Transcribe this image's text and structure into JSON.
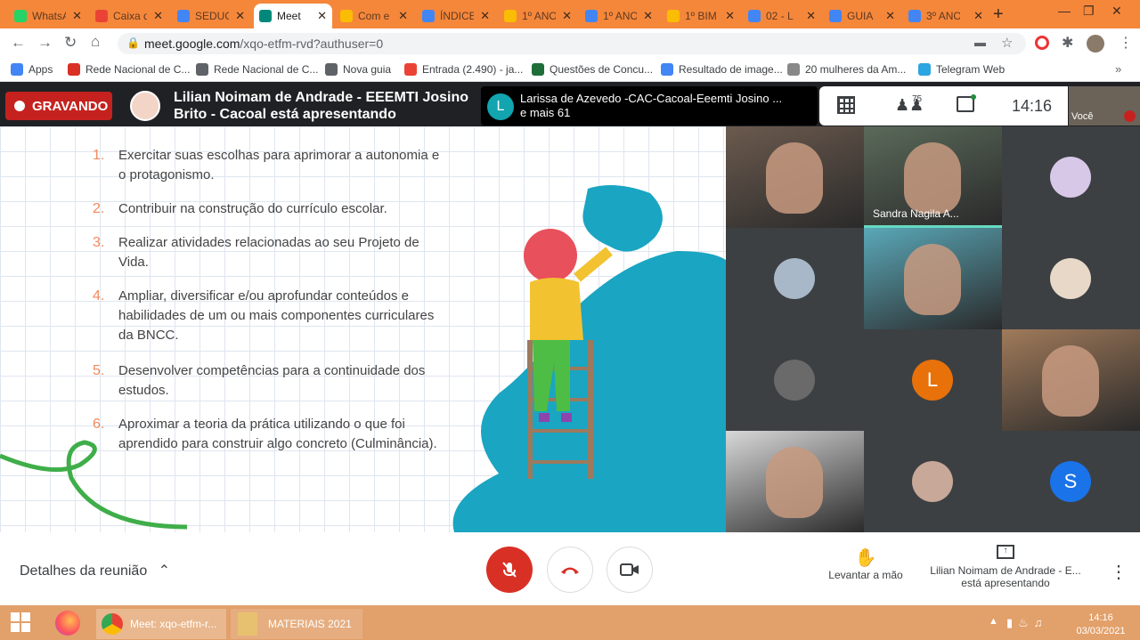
{
  "tabs": [
    {
      "label": "WhatsApp",
      "color": "#25d366"
    },
    {
      "label": "Caixa de",
      "color": "#ea4335"
    },
    {
      "label": "SEDUC",
      "color": "#4285f4"
    },
    {
      "label": "Meet",
      "color": "#00897b"
    },
    {
      "label": "Com e",
      "color": "#fbbc04"
    },
    {
      "label": "ÍNDICE",
      "color": "#4285f4"
    },
    {
      "label": "1º ANO",
      "color": "#fbbc04"
    },
    {
      "label": "1º ANO",
      "color": "#4285f4"
    },
    {
      "label": "1º BIM",
      "color": "#fbbc04"
    },
    {
      "label": "02 - L",
      "color": "#4285f4"
    },
    {
      "label": "GUIA",
      "color": "#4285f4"
    },
    {
      "label": "3º ANO",
      "color": "#4285f4"
    }
  ],
  "address": {
    "host": "meet.google.com",
    "path": "/xqo-etfm-rvd?authuser=0"
  },
  "bookmarks": [
    {
      "label": "Apps",
      "color": "#4285f4"
    },
    {
      "label": "Rede Nacional de C...",
      "color": "#d93025"
    },
    {
      "label": "Rede Nacional de C...",
      "color": "#5f6368"
    },
    {
      "label": "Nova guia",
      "color": "#5f6368"
    },
    {
      "label": "Entrada (2.490) - ja...",
      "color": "#ea4335"
    },
    {
      "label": "Questões de Concu...",
      "color": "#1e6e3a"
    },
    {
      "label": "Resultado de image...",
      "color": "#4285f4"
    },
    {
      "label": "20 mulheres da Am...",
      "color": "#888888"
    },
    {
      "label": "Telegram Web",
      "color": "#2ca5e0"
    }
  ],
  "meet": {
    "recording": "GRAVANDO",
    "presenter_line1": "Lilian Noimam de Andrade - EEEMTI Josino",
    "presenter_line2": "Brito - Cacoal está apresentando",
    "chip_initial": "L",
    "chip_line1": "Larissa de Azevedo -CAC-Cacoal-Eeemti Josino ...",
    "chip_line2": "e mais 61",
    "participants_count": "75",
    "time": "14:16",
    "self_label": "Você"
  },
  "slide": {
    "items": [
      {
        "n": "1.",
        "text": "Exercitar suas escolhas para aprimorar a autonomia e o protagonismo."
      },
      {
        "n": "2.",
        "text": "Contribuir na construção do currículo escolar."
      },
      {
        "n": "3.",
        "text": "Realizar atividades relacionadas ao seu Projeto de Vida."
      },
      {
        "n": "4.",
        "text": "Ampliar, diversificar e/ou aprofundar conteúdos e habilidades de um ou mais componentes curriculares da BNCC."
      },
      {
        "n": "5.",
        "text": "Desenvolver competências para a continuidade dos estudos."
      },
      {
        "n": "6.",
        "text": "Aproximar a teoria da prática utilizando o que foi aprendido para construir algo concreto (Culminância)."
      }
    ]
  },
  "grid": {
    "tiles": [
      {
        "type": "video",
        "color": "#6b5a4e"
      },
      {
        "type": "video",
        "color": "#5a6a5a",
        "name": "Sandra Nagila A..."
      },
      {
        "type": "avatar",
        "color": "#d8c8e8"
      },
      {
        "type": "avatar",
        "color": "#a8b8c8"
      },
      {
        "type": "video",
        "color": "#5aa8b8"
      },
      {
        "type": "avatar",
        "color": "#e8d8c8"
      },
      {
        "type": "avatar",
        "color": "#6a6a6a"
      },
      {
        "type": "letter",
        "letter": "L",
        "color": "#e8710a"
      },
      {
        "type": "video",
        "color": "#a07a5a"
      },
      {
        "type": "video",
        "color": "#d8d8d8"
      },
      {
        "type": "avatar",
        "color": "#c8a898"
      },
      {
        "type": "letter",
        "letter": "S",
        "color": "#1a73e8"
      }
    ]
  },
  "bottom": {
    "details": "Detalhes da reunião",
    "raise_hand": "Levantar a mão",
    "present_line1": "Lilian Noimam de Andrade - E...",
    "present_line2": "está apresentando"
  },
  "taskbar": {
    "chrome_label": "Meet: xqo-etfm-r...",
    "folder_label": "MATERIAIS 2021",
    "clock_time": "14:16",
    "clock_date": "03/03/2021"
  }
}
